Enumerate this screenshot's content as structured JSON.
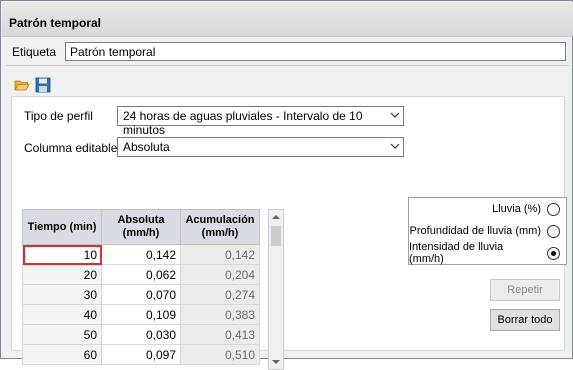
{
  "window": {
    "title": "Patrón temporal"
  },
  "label_field": {
    "label": "Etiqueta",
    "value": "Patrón temporal"
  },
  "toolbar": {
    "open_icon": "folder-open-icon",
    "save_icon": "save-icon"
  },
  "profile": {
    "label": "Tipo de perfil",
    "value": "24 horas de aguas pluviales - Intervalo de 10 minutos"
  },
  "editable_column": {
    "label": "Columna editable",
    "value": "Absoluta"
  },
  "grid": {
    "headers": [
      "Tiempo (min)",
      "Absoluta\n(mm/h)",
      "Acumulación\n(mm/h)"
    ],
    "rows": [
      [
        "10",
        "0,142",
        "0,142"
      ],
      [
        "20",
        "0,062",
        "0,204"
      ],
      [
        "30",
        "0,070",
        "0,274"
      ],
      [
        "40",
        "0,109",
        "0,383"
      ],
      [
        "50",
        "0,030",
        "0,413"
      ],
      [
        "60",
        "0,097",
        "0,510"
      ]
    ]
  },
  "units": {
    "options": [
      "Lluvia (%)",
      "Profundidad de lluvia (mm)",
      "Intensidad de lluvia (mm/h)"
    ],
    "selected": "Intensidad de lluvia (mm/h)"
  },
  "buttons": {
    "repeat": "Repetir",
    "clear_all": "Borrar todo"
  }
}
